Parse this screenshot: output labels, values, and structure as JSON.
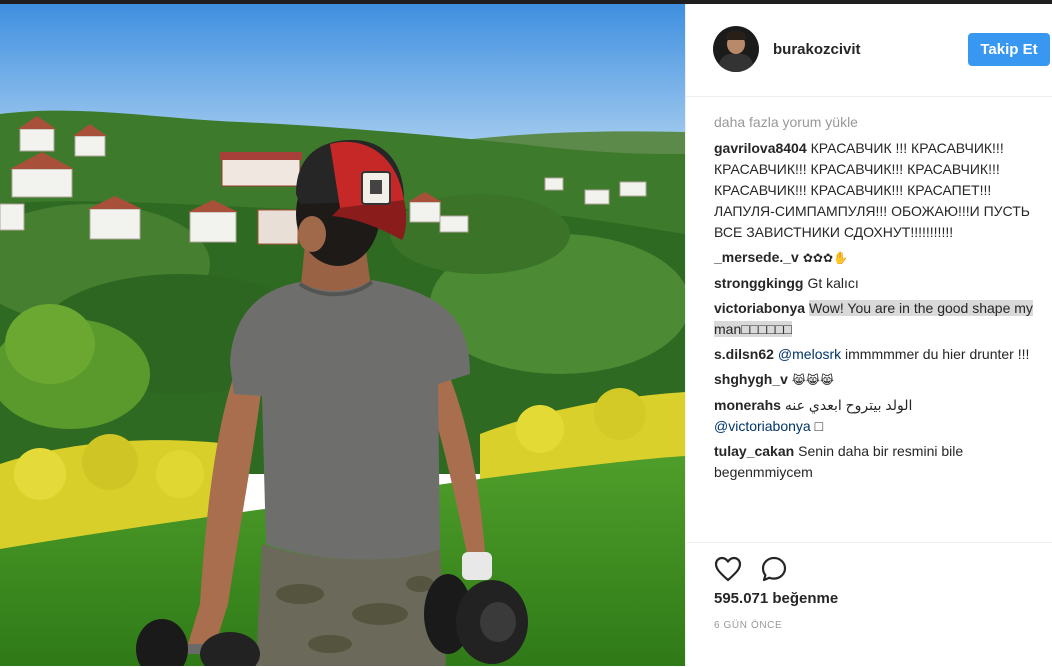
{
  "post": {
    "username": "burakozcivit",
    "follow_label": "Takip Et",
    "load_more_label": "daha fazla yorum yükle",
    "comments": [
      {
        "user": "gavrilova8404",
        "text": "КРАСАВЧИК !!! КРАСАВЧИК!!! КРАСАВЧИК!!! КРАСАВЧИК!!! КРАСАВЧИК!!! КРАСАВЧИК!!! КРАСАВЧИК!!! КРАСАПЕТ!!! ЛАПУЛЯ-СИМПАМПУЛЯ!!! ОБОЖАЮ!!!И ПУСТЬ ВСЕ ЗАВИСТНИКИ СДОХНУТ!!!!!!!!!!!"
      },
      {
        "user": "_mersede._v",
        "text": "✿✿✿✋"
      },
      {
        "user": "stronggkingg",
        "text": "Gt kalıcı"
      },
      {
        "user": "victoriabonya",
        "text": "Wow! You are in the good shape my man□□□□□□"
      },
      {
        "user": "s.dilsn62",
        "mention": "@melosrk",
        "text": "immmmmer du hier drunter !!!"
      },
      {
        "user": "shghygh_v",
        "text": "😹😹😹"
      },
      {
        "user": "monerahs",
        "text": "الولد بيتروح ابعدي عنه",
        "mention": "@victoriabonya",
        "suffix": "□"
      },
      {
        "user": "tulay_cakan",
        "text": "Senin daha bir resmini bile begenmmiycem"
      }
    ],
    "likes_text": "595.071 beğenme",
    "time_text": "6 GÜN ÖNCE"
  },
  "icons": {
    "like": "heart-icon",
    "comment": "comment-bubble-icon"
  },
  "colors": {
    "follow_button": "#3897f0",
    "mention": "#003569",
    "muted_text": "#999999",
    "cap_red": "#c62828"
  }
}
